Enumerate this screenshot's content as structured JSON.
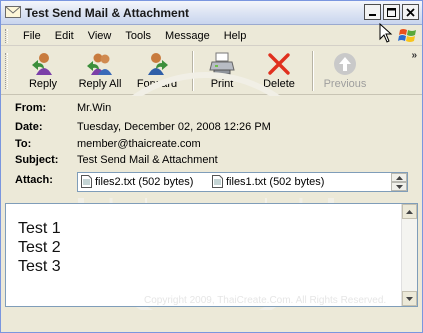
{
  "window": {
    "title": "Test Send Mail & Attachment"
  },
  "menu": {
    "items": [
      "File",
      "Edit",
      "View",
      "Tools",
      "Message",
      "Help"
    ]
  },
  "toolbar": {
    "reply": "Reply",
    "reply_all": "Reply All",
    "forward": "Forward",
    "print": "Print",
    "delete": "Delete",
    "previous": "Previous",
    "overflow": "»"
  },
  "headers": {
    "from_label": "From:",
    "from": "Mr.Win",
    "date_label": "Date:",
    "date": "Tuesday, December 02, 2008 12:26 PM",
    "to_label": "To:",
    "to": "member@thaicreate.com",
    "subject_label": "Subject:",
    "subject": "Test Send Mail & Attachment",
    "attach_label": "Attach:",
    "attachments": [
      "files2.txt (502 bytes)",
      "files1.txt (502 bytes)"
    ]
  },
  "body": {
    "lines": [
      "Test 1",
      "Test 2",
      "Test 3"
    ]
  },
  "watermark": {
    "text": "Copyright 2009, ThaiCreate.Com. All Rights Reserved."
  },
  "colors": {
    "window_bg": "#ece9d8",
    "border": "#7f9db9",
    "delete_red": "#e0301e"
  }
}
